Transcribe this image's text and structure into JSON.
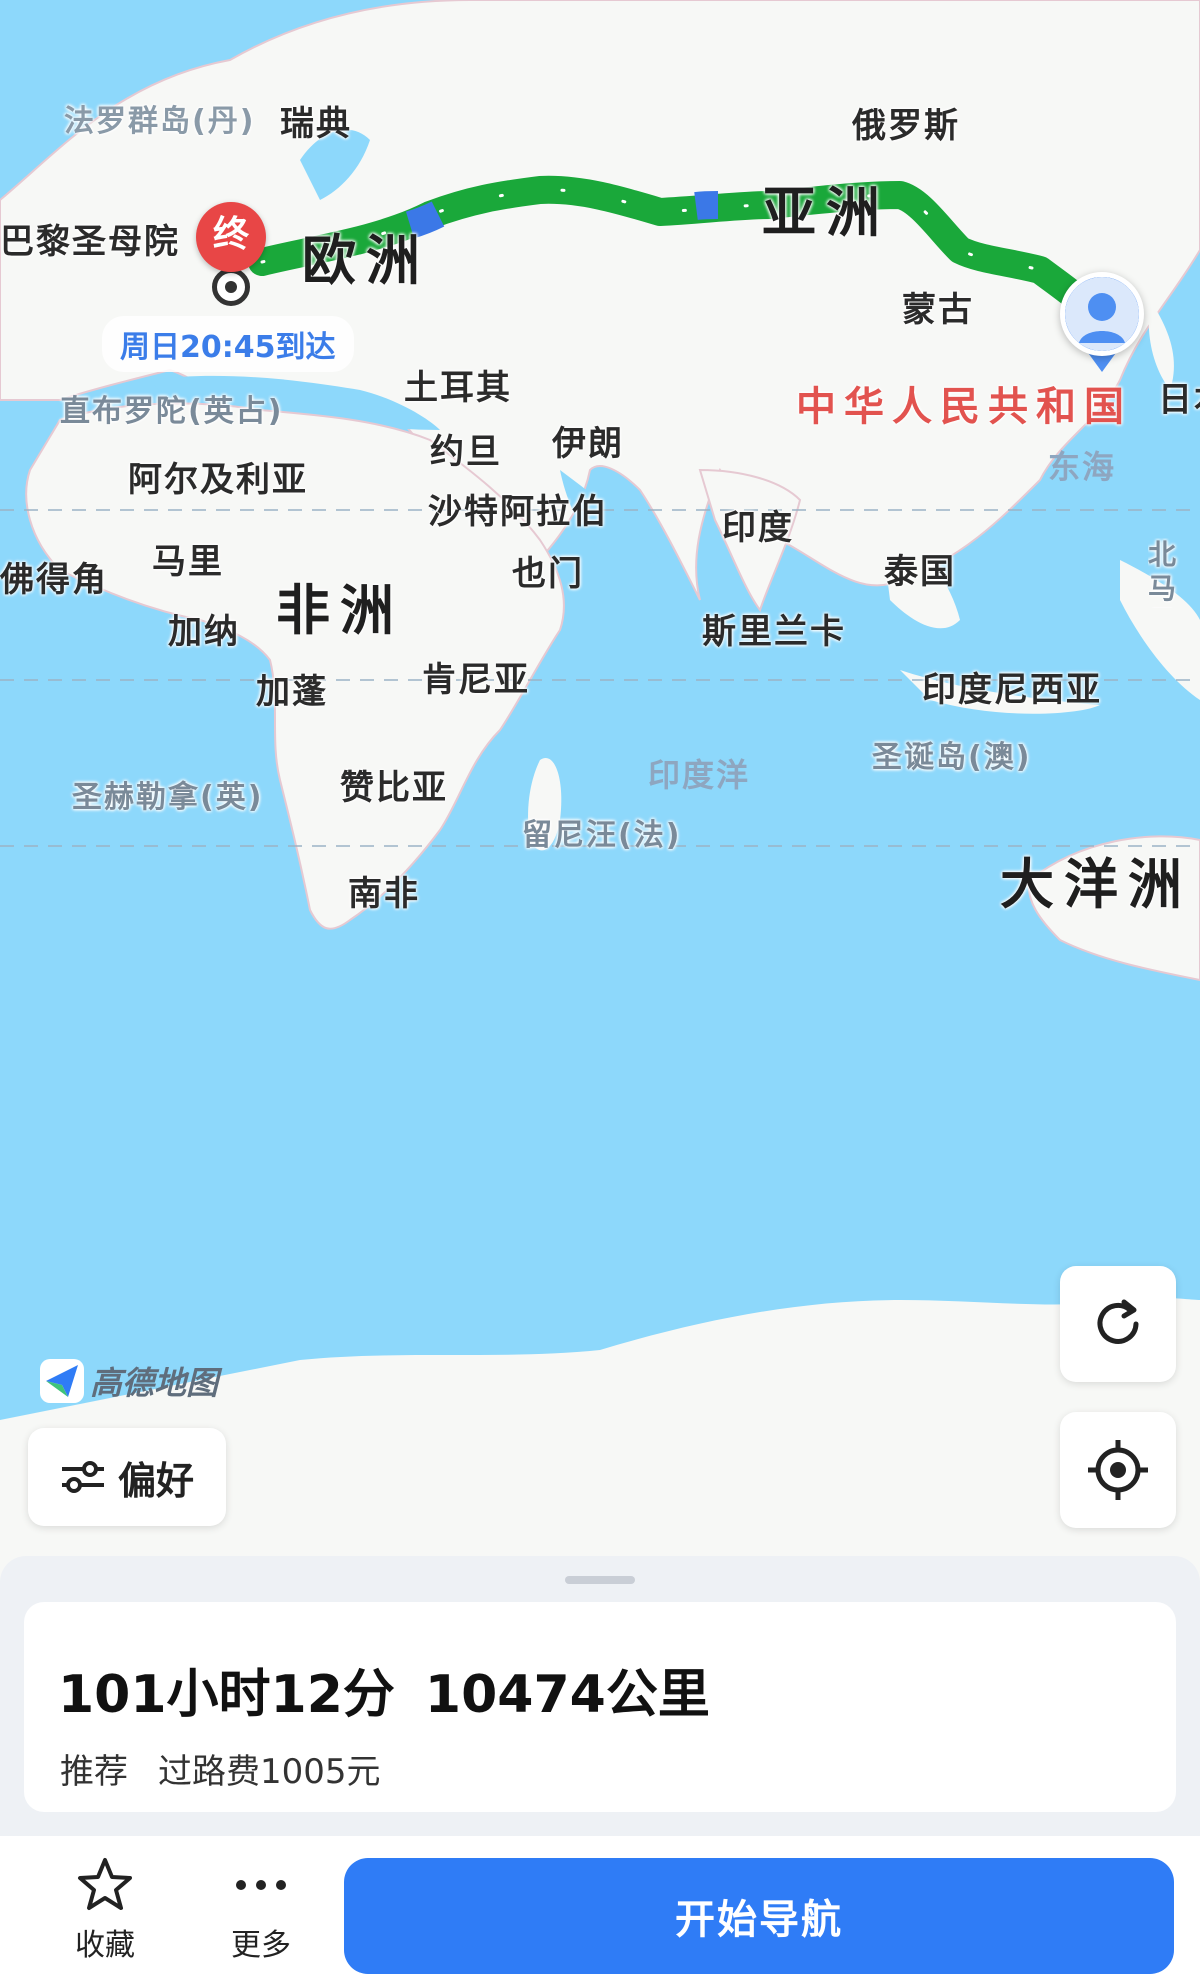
{
  "map": {
    "labels": {
      "faroe": "法罗群岛(丹)",
      "sweden": "瑞典",
      "russia": "俄罗斯",
      "notre_dame": "巴黎圣母院",
      "europe": "欧洲",
      "asia": "亚洲",
      "mongolia": "蒙古",
      "china": "中华人民共和国",
      "japan": "日本",
      "gibraltar": "直布罗陀(英占)",
      "turkey": "土耳其",
      "jordan": "约旦",
      "iran": "伊朗",
      "algeria": "阿尔及利亚",
      "saudi": "沙特阿拉伯",
      "india": "印度",
      "east_sea": "东海",
      "mali": "马里",
      "cape_verde": "佛得角",
      "africa": "非洲",
      "yemen": "也门",
      "thailand": "泰国",
      "n_mariana": "北马里亚纳群岛",
      "ghana": "加纳",
      "sri_lanka": "斯里兰卡",
      "gabon": "加蓬",
      "kenya": "肯尼亚",
      "indonesia": "印度尼西亚",
      "christmas": "圣诞岛(澳)",
      "indian_ocean": "印度洋",
      "st_helena": "圣赫勒拿(英)",
      "zambia": "赞比亚",
      "reunion": "留尼汪(法)",
      "oceania": "大洋洲",
      "south_africa": "南非"
    },
    "eta": "周日20:45到达",
    "end_marker": "终",
    "logo_text": "高德地图"
  },
  "controls": {
    "preference_label": "偏好",
    "refresh_icon": "refresh-icon",
    "locate_icon": "locate-icon"
  },
  "route": {
    "duration": "101小时12分",
    "distance": "10474公里",
    "tag": "推荐",
    "toll": "过路费1005元"
  },
  "bottom": {
    "favorite_label": "收藏",
    "more_label": "更多",
    "navigate_label": "开始导航"
  },
  "colors": {
    "ocean": "#8dd8fb",
    "land": "#f7f8f6",
    "route": "#1aa83a",
    "route_blue": "#3b78e7",
    "primary": "#2f7cf6"
  }
}
